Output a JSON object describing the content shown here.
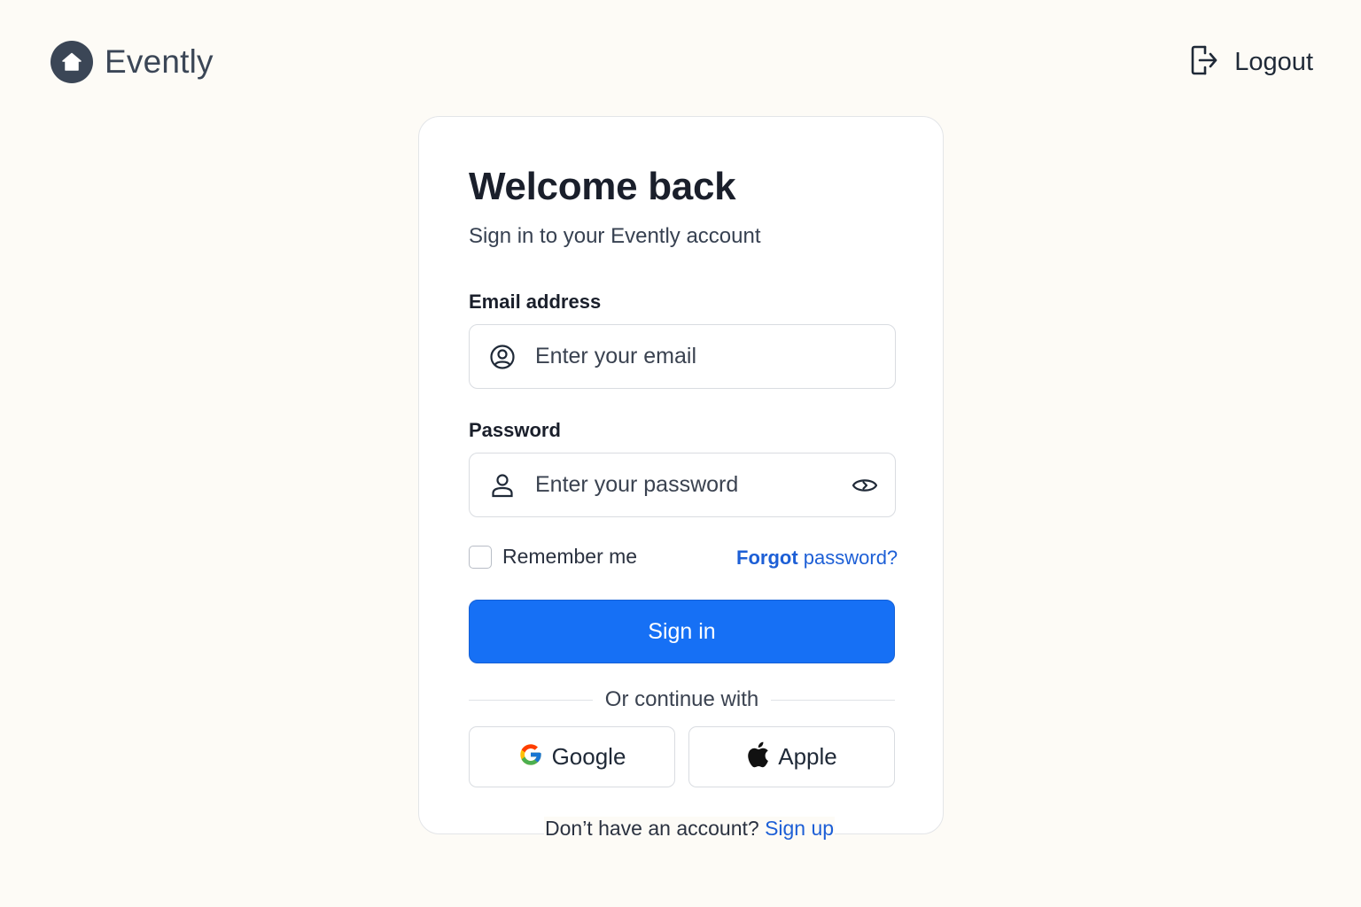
{
  "app": {
    "name": "Evently",
    "logo_icon": "home-icon"
  },
  "header": {
    "logout_label": "Logout",
    "logout_icon": "logout-icon"
  },
  "card": {
    "title": "Welcome back",
    "subtitle": "Sign in to your Evently account",
    "email": {
      "label": "Email address",
      "placeholder": "Enter your email",
      "value": "",
      "icon": "user-circle-icon"
    },
    "password": {
      "label": "Password",
      "placeholder": "Enter your password",
      "value": "",
      "icon": "user-icon",
      "toggle_icon": "eye-icon"
    },
    "remember_me": {
      "label": "Remember me",
      "checked": false
    },
    "forgot_password": {
      "strong": "Forgot",
      "rest": " password?"
    },
    "sign_in_label": "Sign in",
    "divider_text": "Or continue with",
    "social": {
      "google_label": "Google",
      "apple_label": "Apple"
    },
    "signup": {
      "prompt": "Don’t have an account? ",
      "link": "Sign up"
    }
  },
  "colors": {
    "background": "#fdfbf6",
    "primary": "#1670f5",
    "link": "#1d5fd6",
    "brand": "#3b4656"
  }
}
